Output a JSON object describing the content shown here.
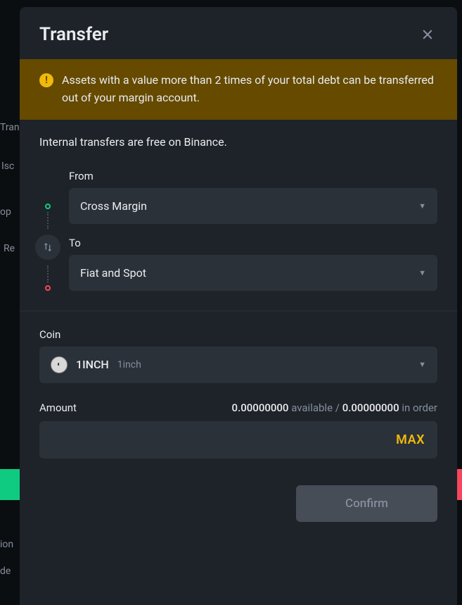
{
  "modal": {
    "title": "Transfer",
    "warning": "Assets with a value more than 2 times of your total debt can be transferred out of your margin account.",
    "info": "Internal transfers are free on Binance.",
    "from_label": "From",
    "from_value": "Cross Margin",
    "to_label": "To",
    "to_value": "Fiat and Spot",
    "coin_label": "Coin",
    "coin_symbol": "1INCH",
    "coin_name": "1inch",
    "amount_label": "Amount",
    "available_value": "0.00000000",
    "available_text": "available",
    "separator": "/",
    "inorder_value": "0.00000000",
    "inorder_text": "in order",
    "max_label": "MAX",
    "confirm_label": "Confirm"
  },
  "background": {
    "tran": "Tran",
    "iso": "Isc",
    "op": "op",
    "re": "Re",
    "ion": "ion",
    "de": "de"
  }
}
